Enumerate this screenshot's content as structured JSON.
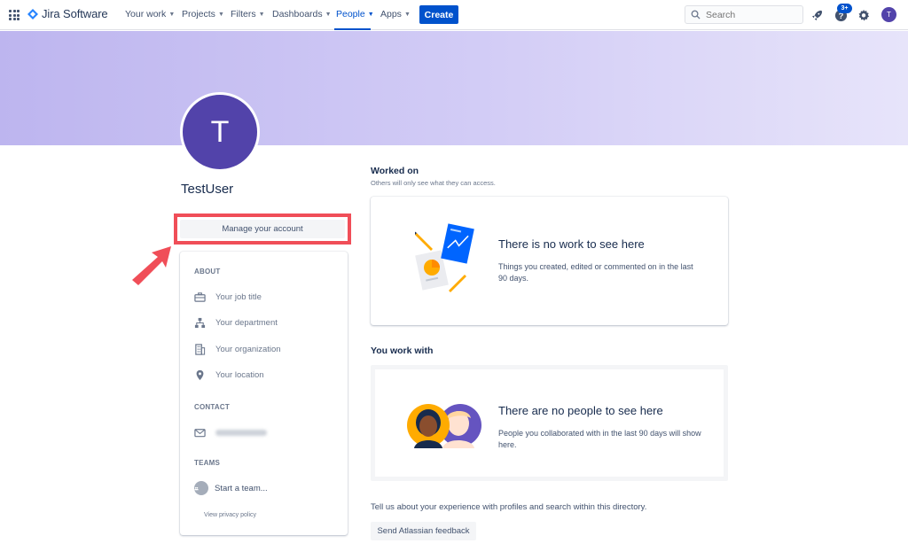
{
  "nav": {
    "brand": "Jira Software",
    "items": [
      {
        "label": "Your work"
      },
      {
        "label": "Projects"
      },
      {
        "label": "Filters"
      },
      {
        "label": "Dashboards"
      },
      {
        "label": "People"
      },
      {
        "label": "Apps"
      }
    ],
    "active": "People",
    "create_label": "Create",
    "search_placeholder": "Search",
    "notification_count": "3+",
    "avatar_initial": "T"
  },
  "profile": {
    "initial": "T",
    "name": "TestUser",
    "manage_label": "Manage your account"
  },
  "about": {
    "about_heading": "ABOUT",
    "job_title": "Your job title",
    "department": "Your department",
    "organization": "Your organization",
    "location": "Your location",
    "contact_heading": "CONTACT",
    "teams_heading": "TEAMS",
    "start_team": "Start a team...",
    "privacy_link": "View privacy policy"
  },
  "worked_on": {
    "title": "Worked on",
    "subtitle": "Others will only see what they can access.",
    "empty_title": "There is no work to see here",
    "empty_body": "Things you created, edited or commented on in the last 90 days."
  },
  "work_with": {
    "title": "You work with",
    "empty_title": "There are no people to see here",
    "empty_body": "People you collaborated with in the last 90 days will show here."
  },
  "feedback": {
    "text": "Tell us about your experience with profiles and search within this directory.",
    "button": "Send Atlassian feedback"
  },
  "colors": {
    "brand_blue": "#0052cc",
    "avatar_purple": "#5243aa",
    "highlight_red": "#f04e58"
  }
}
